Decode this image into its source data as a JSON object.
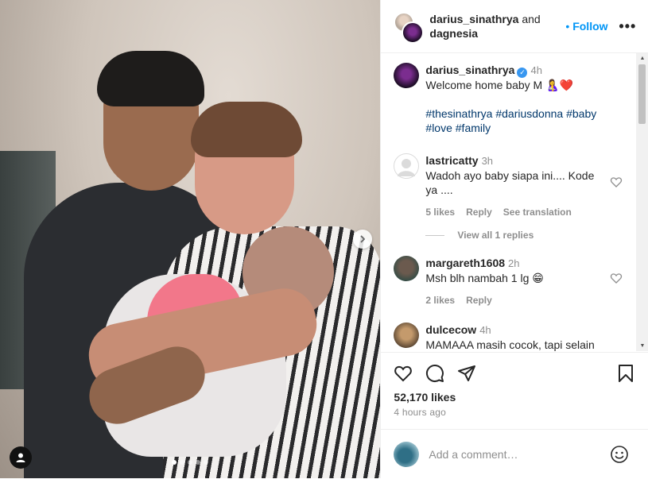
{
  "photo": {
    "carousel_dot_count": 5,
    "carousel_active_index": 0
  },
  "header": {
    "author": "darius_sinathrya",
    "connector": "and",
    "collaborator": "dagnesia",
    "follow_prefix": "•",
    "follow_label": "Follow",
    "more_label": "•••"
  },
  "caption": {
    "username": "darius_sinathrya",
    "time": "4h",
    "text": "Welcome home baby M 🤱❤️",
    "hashtags": "#thesinathrya #dariusdonna #baby #love #family"
  },
  "comments": [
    {
      "username": "lastricatty",
      "time": "3h",
      "text": "Wadoh ayo baby siapa ini.... Kode ya ....",
      "likes": "5 likes",
      "reply": "Reply",
      "translate": "See translation"
    },
    {
      "username": "margareth1608",
      "time": "2h",
      "text": "Msh blh nambah 1 lg 😁",
      "likes": "2 likes",
      "reply": "Reply"
    },
    {
      "username": "dulcecow",
      "time": "4h",
      "text": "MAMAAA masih cocok, tapi selain"
    }
  ],
  "view_replies": "View all 1 replies",
  "stats": {
    "likes": "52,170 likes",
    "time_ago": "4 hours ago"
  },
  "composer": {
    "placeholder": "Add a comment…"
  },
  "colors": {
    "accent": "#0095f6",
    "hashtag": "#00376b",
    "muted": "#8e8e8e",
    "verified": "#3897f0"
  }
}
